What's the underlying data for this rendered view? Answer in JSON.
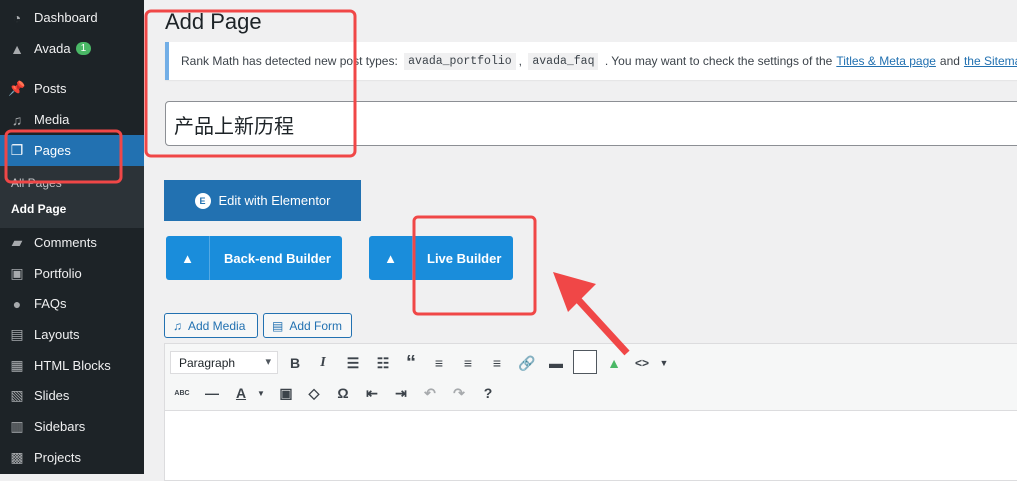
{
  "sidebar": {
    "items": [
      {
        "label": "Dashboard",
        "icon": "dashboard-icon"
      },
      {
        "label": "Avada",
        "icon": "avada-icon",
        "badge": "1"
      },
      {
        "label": "Posts",
        "icon": "pin-icon"
      },
      {
        "label": "Media",
        "icon": "media-icon"
      },
      {
        "label": "Pages",
        "icon": "pages-icon"
      },
      {
        "label": "Comments",
        "icon": "comments-icon"
      },
      {
        "label": "Portfolio",
        "icon": "portfolio-icon"
      },
      {
        "label": "FAQs",
        "icon": "faq-icon"
      },
      {
        "label": "Layouts",
        "icon": "layouts-icon"
      },
      {
        "label": "HTML Blocks",
        "icon": "html-blocks-icon"
      },
      {
        "label": "Slides",
        "icon": "slides-icon"
      },
      {
        "label": "Sidebars",
        "icon": "sidebars-icon"
      },
      {
        "label": "Projects",
        "icon": "projects-icon"
      }
    ],
    "submenu": [
      "All Pages",
      "Add Page"
    ]
  },
  "page_title": "Add Page",
  "notice": {
    "prefix": "Rank Math has detected new post types:",
    "code1": "avada_portfolio",
    "sep": ",",
    "code2": "avada_faq",
    "middle": ". You may want to check the settings of the",
    "link1": "Titles & Meta page",
    "and": "and",
    "link2": "the Sitemap",
    "end": "."
  },
  "title_value": "产品上新历程",
  "buttons": {
    "elementor": "Edit with Elementor",
    "backend": "Back-end Builder",
    "live": "Live Builder",
    "add_media": "Add Media",
    "add_form": "Add Form"
  },
  "editor": {
    "format": "Paragraph"
  },
  "colors": {
    "accent": "#2271b1",
    "avada": "#1a8ddb",
    "annotation": "#f04747"
  }
}
